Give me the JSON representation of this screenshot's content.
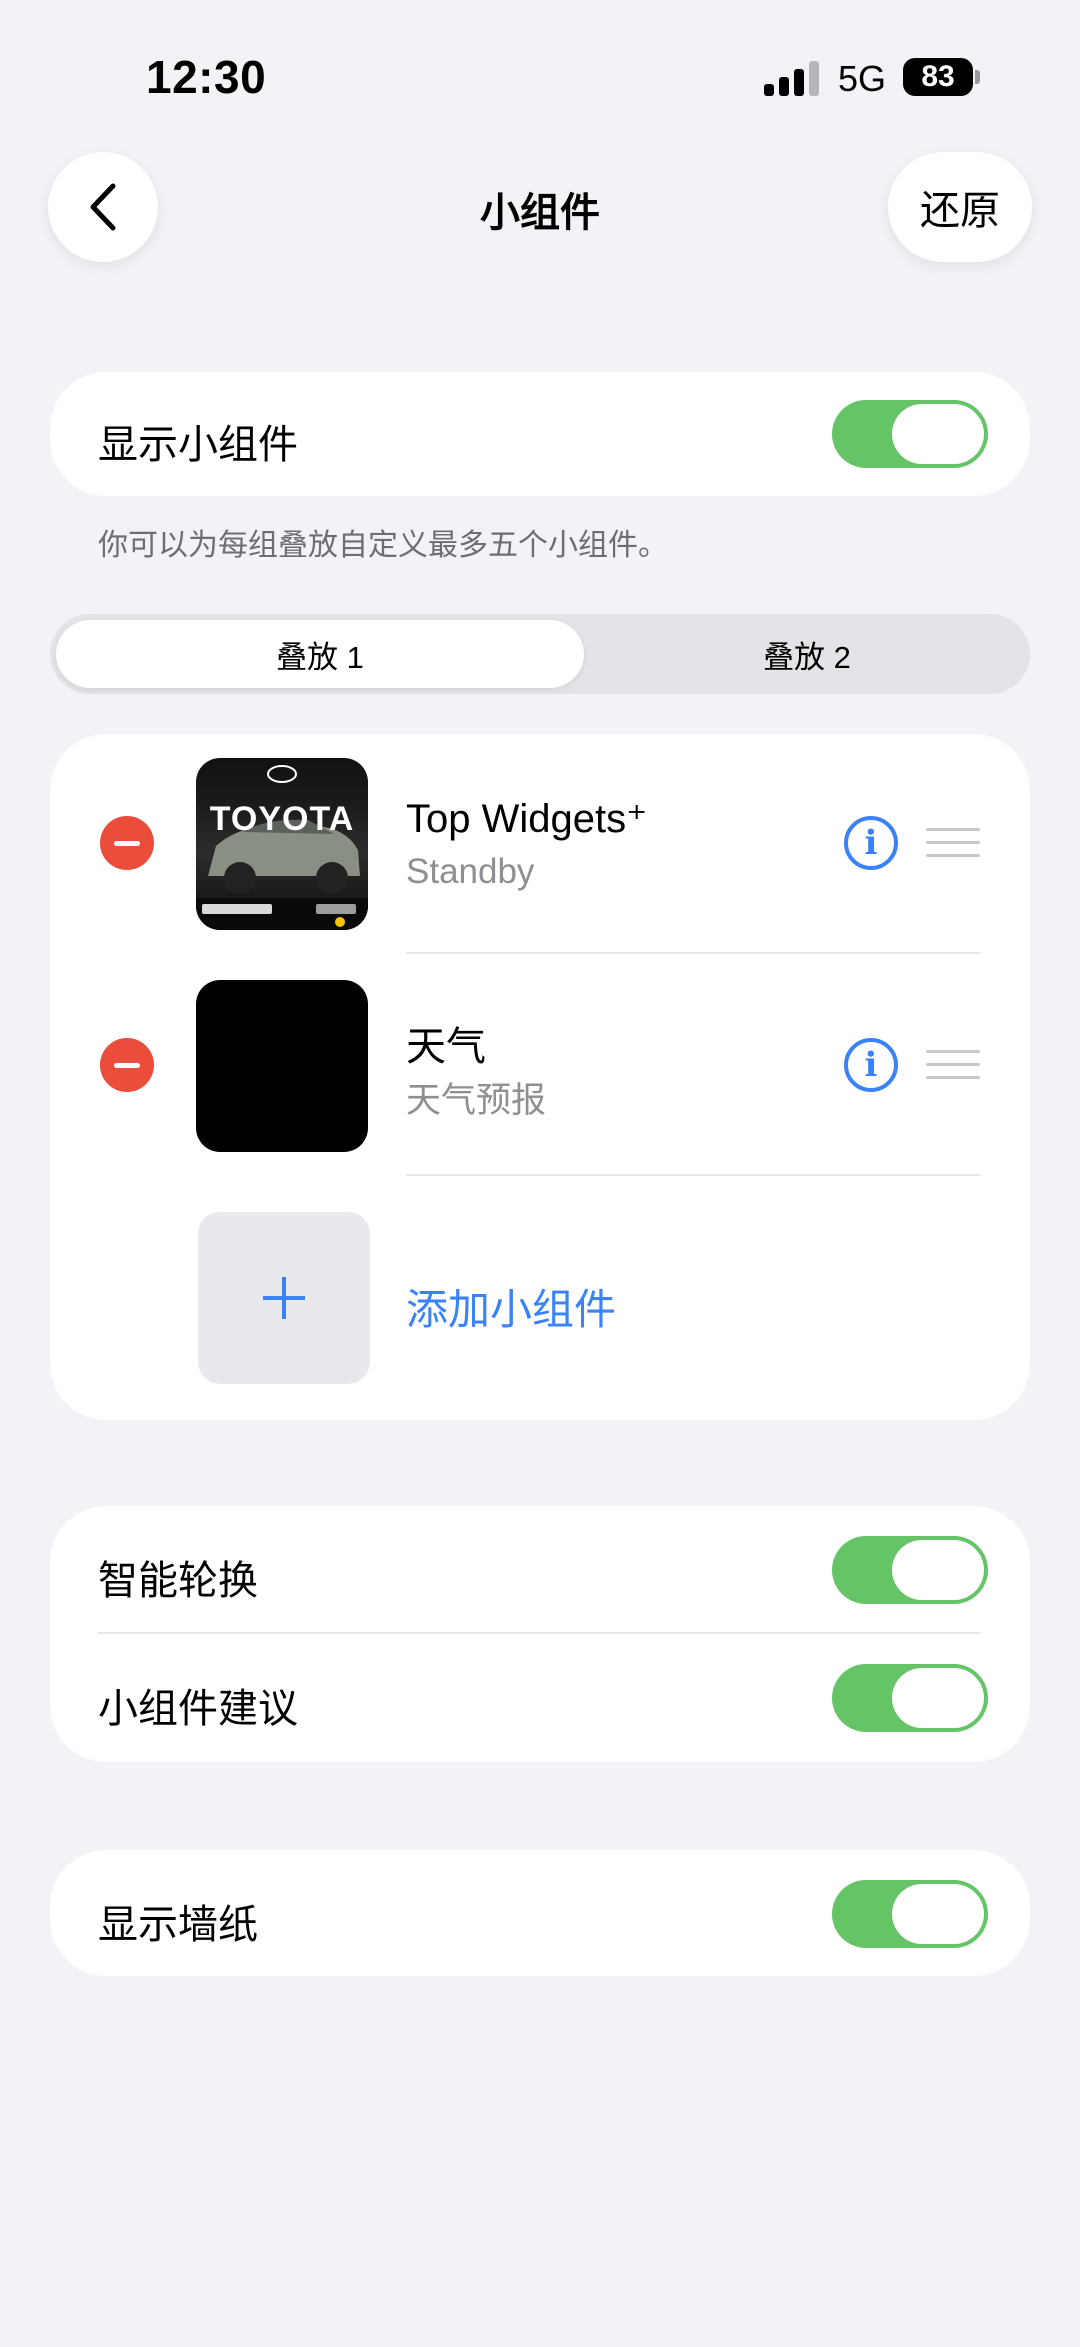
{
  "status": {
    "time": "12:30",
    "network": "5G",
    "battery": "83"
  },
  "nav": {
    "title": "小组件",
    "restore": "还原"
  },
  "show_widgets": {
    "label": "显示小组件",
    "on": true
  },
  "footnote": "你可以为每组叠放自定义最多五个小组件。",
  "stacks": {
    "tabs": [
      "叠放 1",
      "叠放 2"
    ],
    "selected": "叠放 1"
  },
  "widgets": [
    {
      "name": "Top Widgets⁺",
      "subtitle": "Standby",
      "thumb_text": "TOYOTA"
    },
    {
      "name": "天气",
      "subtitle": "天气预报"
    }
  ],
  "add_widget": "添加小组件",
  "options": [
    {
      "label": "智能轮换",
      "on": true
    },
    {
      "label": "小组件建议",
      "on": true
    }
  ],
  "wallpaper": {
    "label": "显示墙纸",
    "on": true
  },
  "colors": {
    "accent": "#3a82f7",
    "toggle_on": "#65c466",
    "remove": "#eb4d3d",
    "background": "#f2f2f7"
  },
  "icons": [
    "signal-bars-icon",
    "battery-icon",
    "back-chevron-icon",
    "remove-icon",
    "info-icon",
    "drag-handle-icon",
    "plus-icon"
  ]
}
